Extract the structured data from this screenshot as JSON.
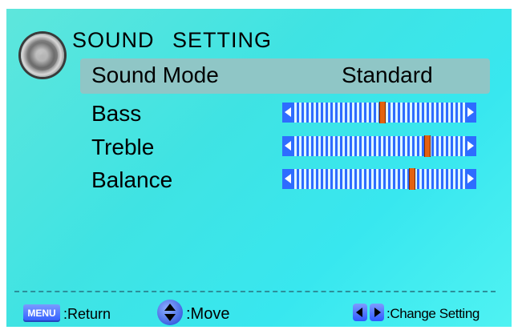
{
  "title": "SOUND SETTING",
  "menu_items": [
    {
      "label": "Sound Mode",
      "value": "Standard",
      "selected": true
    },
    {
      "label": "Bass",
      "level": 0.52
    },
    {
      "label": "Treble",
      "level": 0.78
    },
    {
      "label": "Balance",
      "level": 0.69
    }
  ],
  "footer": {
    "menu_key": "MENU",
    "return_label": ":Return",
    "move_label": ":Move",
    "change_label": ":Change Setting"
  },
  "colors": {
    "background": "#3fe3e3",
    "highlight": "#8fc6c6",
    "slider_blue": "#2e6cff",
    "thumb": "#e3620f"
  },
  "icons": [
    "speaker-icon",
    "up-down-arrows-icon",
    "left-arrow-icon",
    "right-arrow-icon"
  ]
}
